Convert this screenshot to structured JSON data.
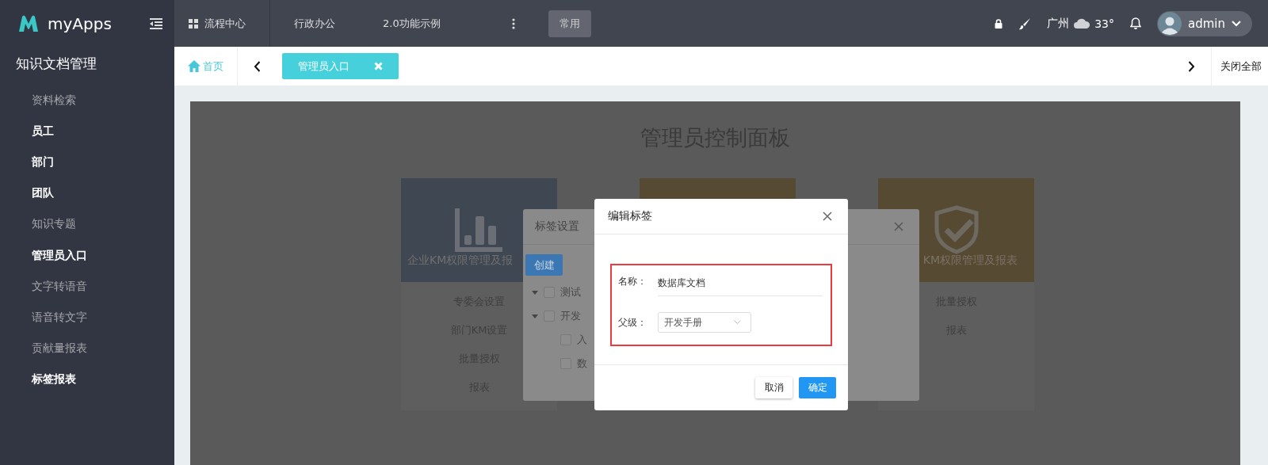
{
  "header": {
    "logo_text": "myApps",
    "nav": [
      {
        "label": "流程中心",
        "kind": "grid"
      },
      {
        "label": "行政办公",
        "kind": "plain"
      },
      {
        "label": "2.0功能示例",
        "kind": "plain"
      }
    ],
    "quick_button": "常用",
    "weather": {
      "city": "广州",
      "temperature": "33°"
    },
    "user": {
      "name": "admin"
    }
  },
  "sidebar": {
    "title": "知识文档管理",
    "items": [
      {
        "label": "资料检索",
        "kind": "link"
      },
      {
        "label": "员工",
        "kind": "group"
      },
      {
        "label": "部门",
        "kind": "group"
      },
      {
        "label": "团队",
        "kind": "group"
      },
      {
        "label": "知识专题",
        "kind": "link"
      },
      {
        "label": "管理员入口",
        "kind": "group"
      },
      {
        "label": "文字转语音",
        "kind": "link"
      },
      {
        "label": "语音转文字",
        "kind": "link"
      },
      {
        "label": "贡献量报表",
        "kind": "link"
      },
      {
        "label": "标签报表",
        "kind": "group"
      }
    ]
  },
  "tabs": {
    "home": "首页",
    "open": [
      {
        "label": "管理员入口",
        "selected": true
      }
    ],
    "close_all": "关闭全部"
  },
  "panel": {
    "title": "管理员控制面板",
    "cards": [
      {
        "title": "企业KM权限管理及报",
        "color": "#3f4753",
        "kind": "chart",
        "links": [
          "专委会设置",
          "部门KM设置",
          "批量授权",
          "报表"
        ]
      },
      {
        "color": "#574a33",
        "kind": "blank"
      },
      {
        "title": "KM权限管理及报表",
        "color": "#574a33",
        "kind": "shield",
        "links": [
          "批量授权",
          "报表"
        ]
      }
    ]
  },
  "tag_dialog": {
    "title": "标签设置",
    "create_button": "创建",
    "tree": [
      {
        "label": "测试",
        "expanded": true,
        "checked": false
      },
      {
        "label": "开发",
        "expanded": true,
        "checked": false,
        "children": [
          {
            "label": "入",
            "checked": false
          },
          {
            "label": "数",
            "checked": false
          }
        ]
      }
    ]
  },
  "edit_dialog": {
    "title": "编辑标签",
    "fields": [
      {
        "label": "名称：",
        "kind": "text",
        "value": "数据库文档"
      },
      {
        "label": "父级：",
        "kind": "select",
        "value": "开发手册"
      }
    ],
    "buttons": [
      {
        "label": "取消",
        "kind": "default"
      },
      {
        "label": "确定",
        "kind": "primary"
      }
    ]
  }
}
